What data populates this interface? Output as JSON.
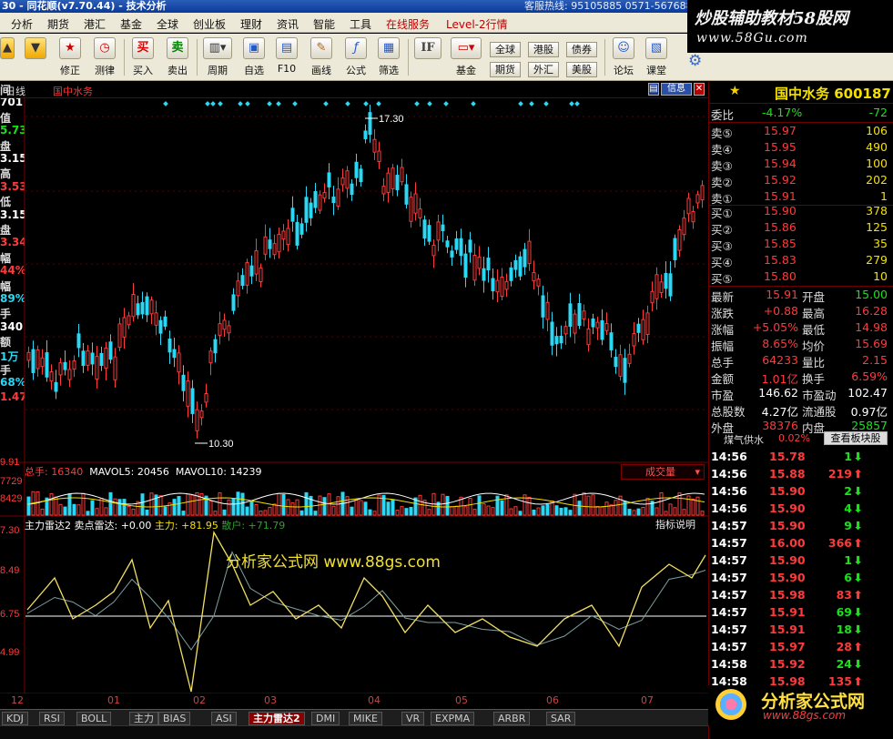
{
  "window": {
    "title": "30 - 同花顺(v7.70.44) - 技术分析",
    "hotline": "客服热线: 95105885  0571-56768888"
  },
  "brand": {
    "line1": "炒股辅助教材58股网",
    "line2": "www.58Gu.com"
  },
  "menu": [
    "分析",
    "期货",
    "港汇",
    "基金",
    "全球",
    "创业板",
    "理财",
    "资讯",
    "智能",
    "工具",
    "在线服务",
    "Level-2行情"
  ],
  "toolbar": [
    {
      "label": "修正",
      "icon": "star-icon"
    },
    {
      "label": "测律",
      "icon": "clock-icon"
    },
    {
      "label": "买入",
      "icon": "buy-icon"
    },
    {
      "label": "卖出",
      "icon": "sell-icon"
    },
    {
      "label": "周期",
      "icon": "cycle-icon"
    },
    {
      "label": "自选",
      "icon": "favorite-icon"
    },
    {
      "label": "F10",
      "icon": "f10-icon"
    },
    {
      "label": "画线",
      "icon": "pencil-icon"
    },
    {
      "label": "公式",
      "icon": "formula-icon"
    },
    {
      "label": "筛选",
      "icon": "filter-icon"
    },
    {
      "label": "基金",
      "icon": "fund-icon"
    },
    {
      "label": "论坛",
      "icon": "forum-icon"
    },
    {
      "label": "课堂",
      "icon": "classroom-icon"
    }
  ],
  "toolbar_small": [
    "全球",
    "港股",
    "债券",
    "期货",
    "外汇",
    "美股"
  ],
  "chart": {
    "period": "日线",
    "stock_name": "国中水务",
    "buttons": {
      "info": "信息",
      "minus": "—",
      "close": "✕"
    },
    "high_label": "17.30",
    "low_label": "10.30"
  },
  "left_values": [
    {
      "text": "间",
      "color": "#dddddd"
    },
    {
      "text": "701",
      "color": "#ffffff"
    },
    {
      "text": "值",
      "color": "#dddddd"
    },
    {
      "text": "5.73",
      "color": "#19e319"
    },
    {
      "text": "盘",
      "color": "#dddddd"
    },
    {
      "text": "3.15",
      "color": "#ffffff"
    },
    {
      "text": "高",
      "color": "#dddddd"
    },
    {
      "text": "3.53",
      "color": "#ff3a3a"
    },
    {
      "text": "低",
      "color": "#dddddd"
    },
    {
      "text": "3.15",
      "color": "#ffffff"
    },
    {
      "text": "盘",
      "color": "#dddddd"
    },
    {
      "text": "3.34",
      "color": "#ff3a3a"
    },
    {
      "text": "幅",
      "color": "#dddddd"
    },
    {
      "text": "44%",
      "color": "#ff3a3a"
    },
    {
      "text": "幅",
      "color": "#dddddd"
    },
    {
      "text": "89%",
      "color": "#2ad8f5"
    },
    {
      "text": "手",
      "color": "#dddddd"
    },
    {
      "text": "340",
      "color": "#ffffff"
    },
    {
      "text": "额",
      "color": "#dddddd"
    },
    {
      "text": "1万",
      "color": "#2ad8f5"
    },
    {
      "text": "手",
      "color": "#dddddd"
    },
    {
      "text": "68%",
      "color": "#2ad8f5"
    },
    {
      "text": "1.47",
      "color": "#ff3a3a"
    }
  ],
  "volume": {
    "label": "总手: 16340",
    "ma5": "MAVOL5: 20456",
    "ma10": "MAVOL10: 14239",
    "selector": "成交量",
    "scale": [
      "9.91",
      "7729",
      "8429"
    ]
  },
  "indicator": {
    "name": "主力雷达2",
    "signal": "卖点雷达: +0.00",
    "main": "主力: +81.95",
    "retail": "散户: +71.79",
    "help_button": "指标说明",
    "scale": [
      "7.30",
      "8.49",
      "6.75",
      "4.99"
    ]
  },
  "watermark": "分析家公式网 www.88gs.com",
  "x_axis": [
    "12",
    "01",
    "02",
    "03",
    "04",
    "05",
    "06",
    "07"
  ],
  "tabs": [
    "KDJ",
    "RSI",
    "BOLL",
    "主力",
    "BIAS",
    "ASI",
    "主力雷达2",
    "DMI",
    "MIKE",
    "VR",
    "EXPMA",
    "ARBR",
    "SAR"
  ],
  "active_tab": "主力雷达2",
  "quote": {
    "name": "国中水务",
    "code": "600187",
    "weibi": {
      "label": "委比",
      "value": "-4.17%",
      "extra": "-72"
    },
    "sells": [
      {
        "label": "卖⑤",
        "price": "15.97",
        "vol": "106"
      },
      {
        "label": "卖④",
        "price": "15.95",
        "vol": "490"
      },
      {
        "label": "卖③",
        "price": "15.94",
        "vol": "100"
      },
      {
        "label": "卖②",
        "price": "15.92",
        "vol": "202"
      },
      {
        "label": "卖①",
        "price": "15.91",
        "vol": "1"
      }
    ],
    "buys": [
      {
        "label": "买①",
        "price": "15.90",
        "vol": "378"
      },
      {
        "label": "买②",
        "price": "15.86",
        "vol": "125"
      },
      {
        "label": "买③",
        "price": "15.85",
        "vol": "35"
      },
      {
        "label": "买④",
        "price": "15.83",
        "vol": "279"
      },
      {
        "label": "买⑤",
        "price": "15.80",
        "vol": "10"
      }
    ],
    "stats": [
      {
        "l1": "最新",
        "v1": "15.91",
        "l2": "开盘",
        "v2": "15.00"
      },
      {
        "l1": "涨跌",
        "v1": "+0.88",
        "l2": "最高",
        "v2": "16.28"
      },
      {
        "l1": "涨幅",
        "v1": "+5.05%",
        "l2": "最低",
        "v2": "14.98"
      },
      {
        "l1": "振幅",
        "v1": "8.65%",
        "l2": "均价",
        "v2": "15.69"
      },
      {
        "l1": "总手",
        "v1": "64233",
        "l2": "量比",
        "v2": "2.15"
      },
      {
        "l1": "金额",
        "v1": "1.01亿",
        "l2": "换手",
        "v2": "6.59%"
      },
      {
        "l1": "市盈",
        "v1": "146.62",
        "l2": "市盈动",
        "v2": "102.47"
      },
      {
        "l1": "总股数",
        "v1": "4.27亿",
        "l2": "流通股",
        "v2": "0.97亿"
      },
      {
        "l1": "外盘",
        "v1": "38376",
        "l2": "内盘",
        "v2": "25857"
      }
    ],
    "mood_label": "煤气供水",
    "mood_value": "0.02%",
    "sector_button": "查看板块股"
  },
  "ticks": [
    {
      "time": "14:56",
      "price": "15.78",
      "vol": "1",
      "dir": "down"
    },
    {
      "time": "14:56",
      "price": "15.88",
      "vol": "219",
      "dir": "up"
    },
    {
      "time": "14:56",
      "price": "15.90",
      "vol": "2",
      "dir": "down"
    },
    {
      "time": "14:56",
      "price": "15.90",
      "vol": "4",
      "dir": "down"
    },
    {
      "time": "14:57",
      "price": "15.90",
      "vol": "9",
      "dir": "down"
    },
    {
      "time": "14:57",
      "price": "16.00",
      "vol": "366",
      "dir": "up"
    },
    {
      "time": "14:57",
      "price": "15.90",
      "vol": "1",
      "dir": "down"
    },
    {
      "time": "14:57",
      "price": "15.90",
      "vol": "6",
      "dir": "down"
    },
    {
      "time": "14:57",
      "price": "15.98",
      "vol": "83",
      "dir": "up"
    },
    {
      "time": "14:57",
      "price": "15.91",
      "vol": "69",
      "dir": "down"
    },
    {
      "time": "14:57",
      "price": "15.91",
      "vol": "18",
      "dir": "down"
    },
    {
      "time": "14:57",
      "price": "15.97",
      "vol": "28",
      "dir": "up"
    },
    {
      "time": "14:58",
      "price": "15.92",
      "vol": "24",
      "dir": "down"
    },
    {
      "time": "14:58",
      "price": "15.98",
      "vol": "135",
      "dir": "up"
    }
  ],
  "logo": {
    "line1": "分析家公式网",
    "line2": "www.88gs.com"
  },
  "colors": {
    "up": "#ff3a3a",
    "down": "#19e319",
    "accent": "#f3e000",
    "cyan": "#2ad8f5",
    "frame": "#7a0000"
  }
}
